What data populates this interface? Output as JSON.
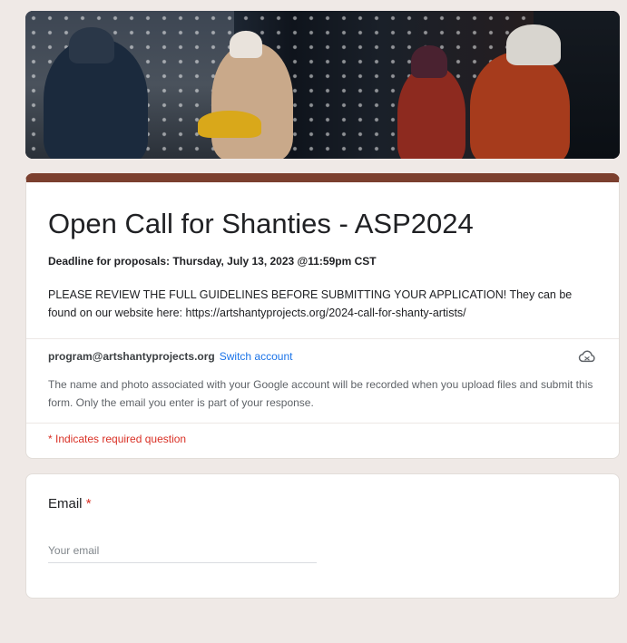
{
  "form": {
    "title": "Open Call for Shanties - ASP2024",
    "deadline": "Deadline for proposals: Thursday, July 13, 2023 @11:59pm CST",
    "description": "PLEASE REVIEW THE FULL GUIDELINES BEFORE SUBMITTING YOUR APPLICATION! They can be found on our website here: https://artshantyprojects.org/2024-call-for-shanty-artists/",
    "theme_color": "#7b3f2e"
  },
  "account": {
    "email": "program@artshantyprojects.org",
    "switch_label": "Switch account",
    "icon": "cloud-off-icon",
    "notice": "The name and photo associated with your Google account will be recorded when you upload files and submit this form. Only the email you enter is part of your response."
  },
  "required_note": "* Indicates required question",
  "questions": {
    "email": {
      "label": "Email",
      "required_mark": "*",
      "placeholder": "Your email"
    }
  },
  "colors": {
    "required": "#d93025",
    "link": "#1a73e8"
  }
}
